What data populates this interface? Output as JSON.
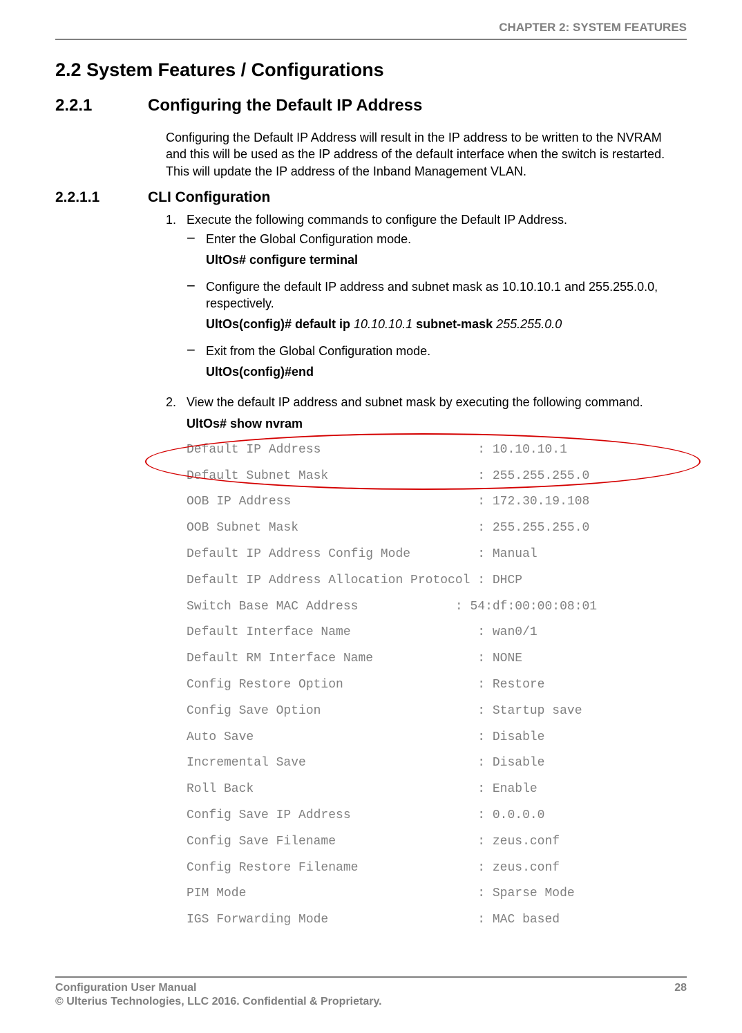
{
  "header": {
    "chapter": "CHAPTER 2: SYSTEM FEATURES"
  },
  "h1": {
    "num": "2.2",
    "title": "System Features / Configurations"
  },
  "h2": {
    "num": "2.2.1",
    "title": "Configuring the Default IP Address"
  },
  "intro": "Configuring the Default IP Address will result in the IP address to be written to the NVRAM and this will be used as the IP address of the default interface when the switch is restarted. This will update the IP address of the Inband Management VLAN.",
  "h3": {
    "num": "2.2.1.1",
    "title": "CLI Configuration"
  },
  "step1": {
    "num": "1.",
    "text": "Execute the following commands to configure the Default IP Address.",
    "d1": {
      "text": "Enter the Global Configuration mode.",
      "cmd": "UltOs# configure terminal"
    },
    "d2": {
      "text": "Configure the default IP address and subnet mask as 10.10.10.1 and 255.255.0.0, respectively.",
      "cmd_prefix": "UltOs(config)# default ip  ",
      "cmd_arg1": "10.10.10.1",
      "cmd_mid": " subnet-mask ",
      "cmd_arg2": "255.255.0.0"
    },
    "d3": {
      "text": "Exit from the Global Configuration mode.",
      "cmd": "UltOs(config)#end"
    }
  },
  "step2": {
    "num": "2.",
    "text": "View the default IP address and subnet mask by executing the following command.",
    "cmd": "UltOs# show nvram"
  },
  "nvram": {
    "lines": [
      "Default IP Address                     : 10.10.10.1",
      "Default Subnet Mask                    : 255.255.255.0",
      "OOB IP Address                         : 172.30.19.108",
      "OOB Subnet Mask                        : 255.255.255.0",
      "Default IP Address Config Mode         : Manual",
      "Default IP Address Allocation Protocol : DHCP",
      "Switch Base MAC Address             : 54:df:00:00:08:01",
      "Default Interface Name                 : wan0/1",
      "Default RM Interface Name              : NONE",
      "Config Restore Option                  : Restore",
      "Config Save Option                     : Startup save",
      "Auto Save                              : Disable",
      "Incremental Save                       : Disable",
      "Roll Back                              : Enable",
      "Config Save IP Address                 : 0.0.0.0",
      "Config Save Filename                   : zeus.conf",
      "Config Restore Filename                : zeus.conf",
      "PIM Mode                               : Sparse Mode",
      "IGS Forwarding Mode                    : MAC based"
    ]
  },
  "footer": {
    "title": "Configuration User Manual",
    "page": "28",
    "copyright": "© Ulterius Technologies, LLC 2016. Confidential & Proprietary."
  }
}
